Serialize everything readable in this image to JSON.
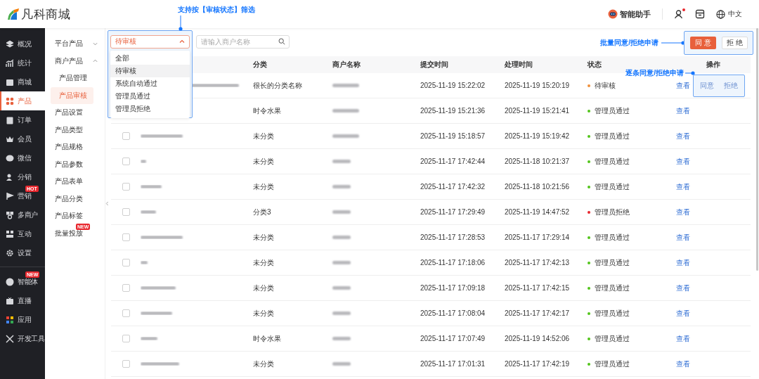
{
  "header": {
    "logo": "凡科商城",
    "assistant": "智能助手",
    "user_alert": true,
    "language": "中文"
  },
  "nav_groups": [
    {
      "items": [
        {
          "label": "概况",
          "selected": false
        },
        {
          "label": "统计",
          "selected": false
        },
        {
          "label": "商城",
          "selected": false
        },
        {
          "label": "产品",
          "selected": true
        },
        {
          "label": "订单",
          "selected": false
        },
        {
          "label": "会员",
          "selected": false
        },
        {
          "label": "微信",
          "selected": false
        },
        {
          "label": "分销",
          "selected": false
        },
        {
          "label": "营销",
          "selected": false,
          "badge": "HOT"
        },
        {
          "label": "多商户",
          "selected": false
        },
        {
          "label": "互动",
          "selected": false
        },
        {
          "label": "设置",
          "selected": false
        }
      ]
    },
    {
      "items": [
        {
          "label": "智能体",
          "selected": false,
          "badge": "NEW"
        },
        {
          "label": "直播",
          "selected": false
        },
        {
          "label": "应用",
          "selected": false
        },
        {
          "label": "开发工具",
          "selected": false
        }
      ]
    }
  ],
  "subnav": [
    {
      "label": "平台产品",
      "selected": false,
      "expanded": false
    },
    {
      "label": "商户产品",
      "selected": false,
      "expanded": true,
      "children": [
        {
          "label": "产品管理",
          "selected": false
        },
        {
          "label": "产品审核",
          "selected": true
        }
      ]
    },
    {
      "label": "产品设置",
      "selected": false
    },
    {
      "label": "产品类型",
      "selected": false
    },
    {
      "label": "产品规格",
      "selected": false
    },
    {
      "label": "产品参数",
      "selected": false
    },
    {
      "label": "产品表单",
      "selected": false
    },
    {
      "label": "产品分类",
      "selected": false
    },
    {
      "label": "产品标签",
      "selected": false
    },
    {
      "label": "批量投放",
      "selected": false,
      "badge": "NEW"
    }
  ],
  "filter": {
    "callout": "支持按【审核状态】筛选",
    "value": "待审核",
    "open": true,
    "options": [
      {
        "label": "全部",
        "selected": false
      },
      {
        "label": "待审核",
        "selected": true
      },
      {
        "label": "系统自动通过",
        "selected": false
      },
      {
        "label": "管理员通过",
        "selected": false
      },
      {
        "label": "管理员拒绝",
        "selected": false
      }
    ]
  },
  "search": {
    "placeholder": "请输入商户名称"
  },
  "batch": {
    "callout": "批量同意/拒绝申请",
    "buttons": [
      {
        "label": "同 意",
        "kind": "primary"
      },
      {
        "label": "拒 绝",
        "kind": "default"
      }
    ]
  },
  "table": {
    "columns": [
      "分类",
      "商户名称",
      "提交时间",
      "处理时间",
      "状态",
      "操作"
    ],
    "rows": [
      {
        "category": "很长的分类名称",
        "submitted": "2025-11-19 15:22:02",
        "processed": "2025-11-19 15:20:19",
        "status": "待审核",
        "color": "#f0903a",
        "view": "查看",
        "review_actions": [
          "同意",
          "拒绝"
        ],
        "callout": "逐条同意/拒绝申请"
      },
      {
        "category": "时令水果",
        "submitted": "2025-11-19 15:21:36",
        "processed": "2025-11-19 15:21:41",
        "status": "管理员通过",
        "color": "#52c41a",
        "view": "查看"
      },
      {
        "checked": false,
        "category": "未分类",
        "submitted": "2025-11-19 15:18:57",
        "processed": "2025-11-19 15:19:42",
        "status": "管理员通过",
        "color": "#52c41a",
        "view": "查看"
      },
      {
        "checked": false,
        "category": "未分类",
        "submitted": "2025-11-17 17:42:44",
        "processed": "2025-11-18 10:21:37",
        "status": "管理员通过",
        "color": "#52c41a",
        "view": "查看"
      },
      {
        "checked": false,
        "category": "未分类",
        "submitted": "2025-11-17 17:42:32",
        "processed": "2025-11-18 10:21:56",
        "status": "管理员通过",
        "color": "#52c41a",
        "view": "查看"
      },
      {
        "checked": false,
        "category": "分类3",
        "submitted": "2025-11-17 17:29:49",
        "processed": "2025-11-19 14:47:52",
        "status": "管理员拒绝",
        "color": "#e8262d",
        "view": "查看"
      },
      {
        "checked": false,
        "category": "未分类",
        "submitted": "2025-11-17 17:28:53",
        "processed": "2025-11-17 17:29:14",
        "status": "管理员通过",
        "color": "#52c41a",
        "view": "查看"
      },
      {
        "checked": false,
        "category": "未分类",
        "submitted": "2025-11-17 17:18:06",
        "processed": "2025-11-17 17:42:13",
        "status": "管理员通过",
        "color": "#52c41a",
        "view": "查看"
      },
      {
        "checked": false,
        "category": "未分类",
        "submitted": "2025-11-17 17:09:18",
        "processed": "2025-11-17 17:42:15",
        "status": "管理员通过",
        "color": "#52c41a",
        "view": "查看"
      },
      {
        "checked": false,
        "category": "未分类",
        "submitted": "2025-11-17 17:08:04",
        "processed": "2025-11-17 17:42:17",
        "status": "管理员通过",
        "color": "#52c41a",
        "view": "查看"
      },
      {
        "checked": false,
        "category": "时令水果",
        "submitted": "2025-11-17 17:07:49",
        "processed": "2025-11-19 14:52:06",
        "status": "管理员通过",
        "color": "#52c41a",
        "view": "查看"
      },
      {
        "checked": false,
        "category": "未分类",
        "submitted": "2025-11-17 17:01:31",
        "processed": "2025-11-17 17:42:19",
        "status": "管理员通过",
        "color": "#52c41a",
        "view": "查看"
      }
    ]
  }
}
